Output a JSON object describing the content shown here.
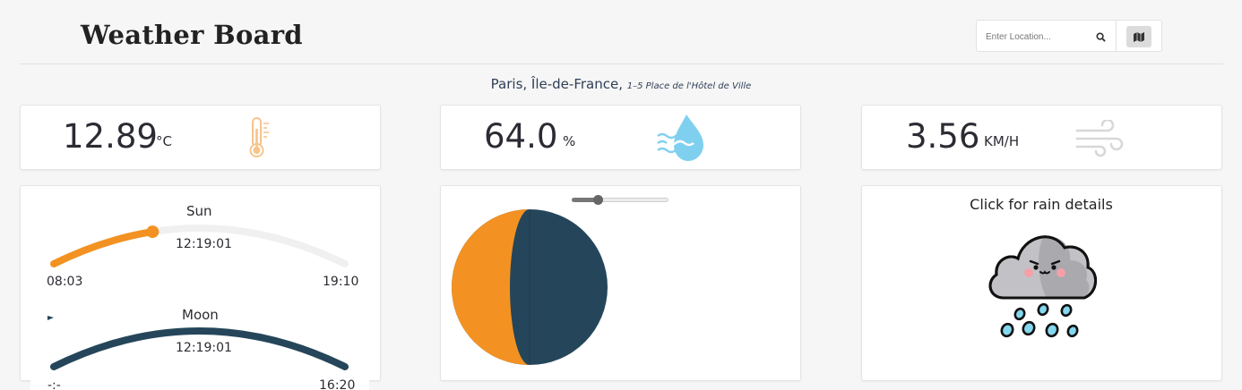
{
  "header": {
    "brand": "Weather Board"
  },
  "search": {
    "placeholder": "Enter Location...",
    "search_icon": "search-icon",
    "map_icon": "map-icon"
  },
  "location": {
    "city": "Paris, Île-de-France,",
    "address": "1–5 Place de l'Hôtel de Ville"
  },
  "stats": {
    "temperature": {
      "value": "12.89",
      "unit": "°C",
      "icon": "thermometer-icon",
      "color": "#f6c48c"
    },
    "humidity": {
      "value": "64.0",
      "unit": "%",
      "icon": "humidity-drop-icon",
      "color": "#7fd0ef"
    },
    "wind": {
      "value": "3.56",
      "unit": "KM/H",
      "icon": "wind-icon",
      "color": "#d8d8d8"
    }
  },
  "sun": {
    "label": "Sun",
    "now": "12:19:01",
    "rise": "08:03",
    "set": "19:10",
    "progress": 0.34,
    "color": "#f39222"
  },
  "moon": {
    "label": "Moon",
    "now": "12:19:01",
    "rise": "-:-",
    "set": "16:20",
    "color": "#25465a"
  },
  "moon_phase": {
    "slider_value": 0.27,
    "light_color": "#f39222",
    "dark_color": "#25465a"
  },
  "rain": {
    "title": "Click for rain details",
    "icon": "rain-cloud-icon"
  },
  "colors": {
    "orange": "#f39222",
    "navy": "#25465a",
    "track": "#f0f0f0"
  }
}
